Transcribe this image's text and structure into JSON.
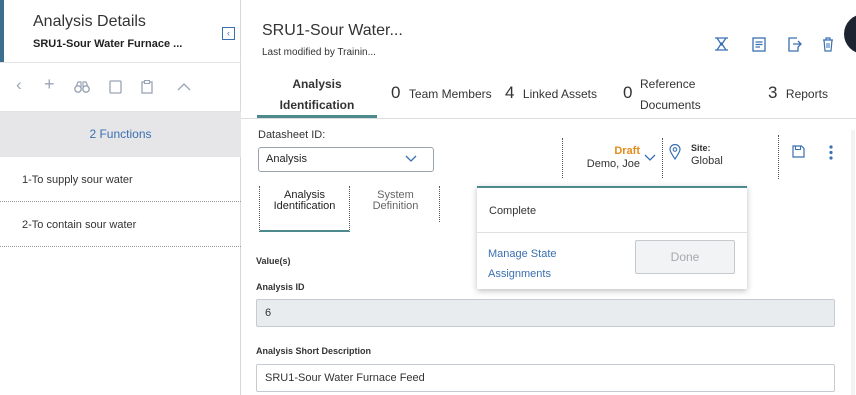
{
  "left": {
    "title": "Analysis Details",
    "subtitle": "SRU1-Sour Water Furnace ...",
    "collapse_icon": "‹",
    "toolbar_icons": [
      "chevron-left-icon",
      "plus-icon",
      "binoculars-icon",
      "copy-icon",
      "paste-icon",
      "chevron-up-icon"
    ],
    "functions_label": "2 Functions",
    "functions": [
      "1-To supply sour water",
      "2-To contain sour water"
    ]
  },
  "header": {
    "title": "SRU1-Sour Water...",
    "subtitle": "Last modified by Trainin...",
    "icons": [
      "hierarchy-icon",
      "report-icon",
      "export-icon",
      "delete-icon"
    ]
  },
  "tabs": [
    {
      "line1": "Analysis",
      "line2": "Identification"
    },
    {
      "num": "0",
      "label": "Team Members"
    },
    {
      "num": "4",
      "label": "Linked Assets"
    },
    {
      "num": "0",
      "line1": "Reference",
      "line2": "Documents"
    },
    {
      "num": "3",
      "label": "Reports"
    }
  ],
  "datasheet": {
    "label": "Datasheet ID:",
    "value": "Analysis",
    "state": "Draft",
    "owner": "Demo, Joe",
    "site_label": "Site:",
    "site_value": "Global"
  },
  "inner_tabs": [
    {
      "line1": "Analysis",
      "line2": "Identification"
    },
    {
      "line1": "System",
      "line2": "Definition"
    }
  ],
  "popup": {
    "complete": "Complete",
    "manage_link": "Manage State Assignments",
    "done_label": "Done"
  },
  "form": {
    "values_label": "Value(s)",
    "analysis_id_label": "Analysis ID",
    "analysis_id_value": "6",
    "short_desc_label": "Analysis Short Description",
    "short_desc_value": "SRU1-Sour Water Furnace Feed"
  },
  "colors": {
    "accent": "#3a6fb0",
    "tab_underline": "#4c8a8e",
    "draft": "#e38b1c",
    "functions_bg": "#e6e6e9"
  }
}
